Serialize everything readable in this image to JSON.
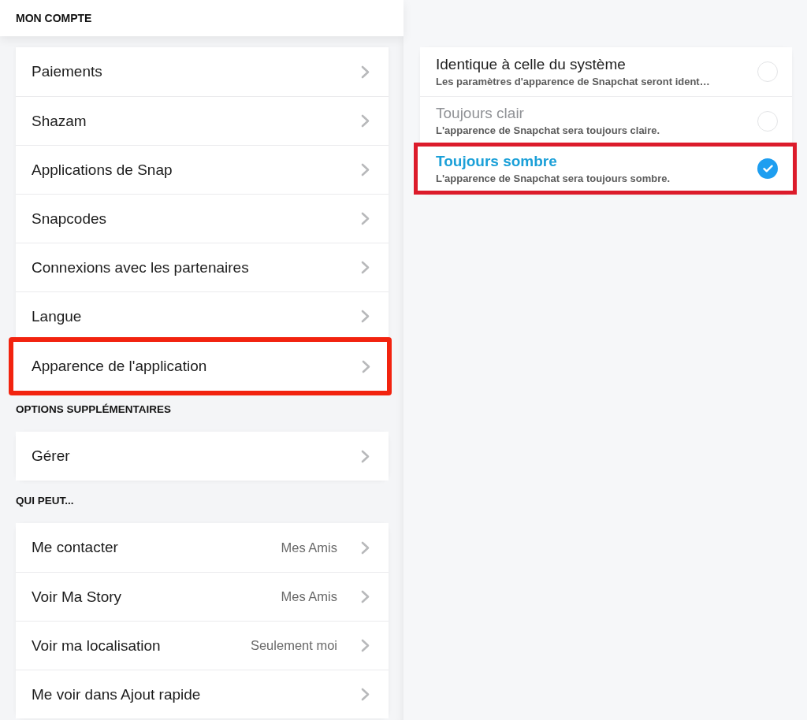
{
  "header": {
    "title": "MON COMPTE"
  },
  "groups": [
    {
      "items": [
        {
          "label": "Paiements",
          "highlighted": false
        },
        {
          "label": "Shazam",
          "highlighted": false
        },
        {
          "label": "Applications de Snap",
          "highlighted": false
        },
        {
          "label": "Snapcodes",
          "highlighted": false
        },
        {
          "label": "Connexions avec les partenaires",
          "highlighted": false
        },
        {
          "label": "Langue",
          "highlighted": false
        },
        {
          "label": "Apparence de l'application",
          "highlighted": true
        }
      ]
    },
    {
      "title": "OPTIONS SUPPLÉMENTAIRES",
      "items": [
        {
          "label": "Gérer",
          "highlighted": false
        }
      ]
    },
    {
      "title": "QUI PEUT...",
      "items": [
        {
          "label": "Me contacter",
          "value": "Mes Amis",
          "highlighted": false
        },
        {
          "label": "Voir Ma Story",
          "value": "Mes Amis",
          "highlighted": false
        },
        {
          "label": "Voir ma localisation",
          "value": "Seulement moi",
          "highlighted": false
        },
        {
          "label": "Me voir dans Ajout rapide",
          "highlighted": false
        }
      ]
    }
  ],
  "appearance": {
    "options": [
      {
        "title": "Identique à celle du système",
        "subtitle": "Les paramètres d'apparence de Snapchat seront ident…",
        "selected": false,
        "dimmed": false,
        "highlighted": false
      },
      {
        "title": "Toujours clair",
        "subtitle": "L'apparence de Snapchat sera toujours claire.",
        "selected": false,
        "dimmed": true,
        "highlighted": false
      },
      {
        "title": "Toujours sombre",
        "subtitle": "L'apparence de Snapchat sera toujours sombre.",
        "selected": true,
        "dimmed": false,
        "highlighted": true
      }
    ]
  }
}
